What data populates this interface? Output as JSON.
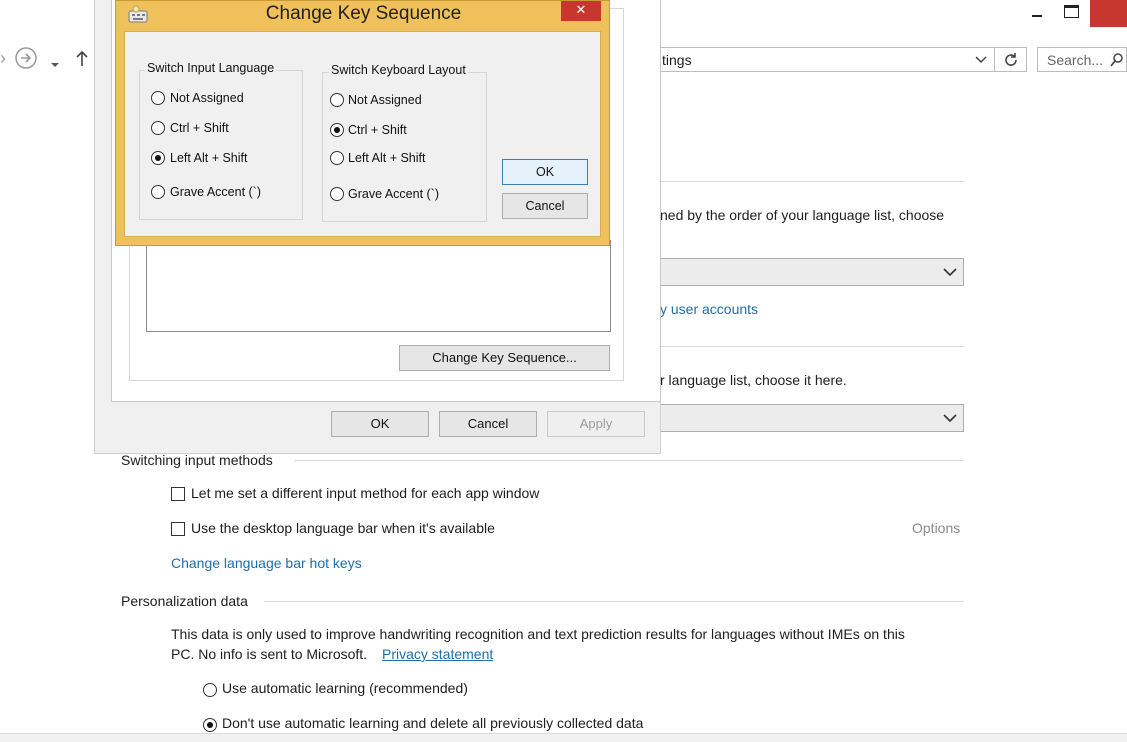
{
  "window": {
    "search_placeholder": "Search...",
    "address_text": "tings",
    "controls": {
      "minimize": "—",
      "maximize": "☐",
      "close": "✕"
    }
  },
  "main": {
    "text_order": "ned by the order of your language list, choose",
    "link_user_accounts": "y user accounts",
    "text_language_list": "r language list, choose it here.",
    "switching": {
      "header": "Switching input methods",
      "cb1_label": "Let me set a different input method for each app window",
      "cb2_label": "Use the desktop language bar when it's available",
      "options_label": "Options",
      "hotkeys_link": "Change language bar hot keys"
    },
    "personalization": {
      "header": "Personalization data",
      "desc_line1": "This data is only used to improve handwriting recognition and text prediction results for languages without IMEs on this",
      "desc_line2": "PC. No info is sent to Microsoft.",
      "privacy_link": "Privacy statement",
      "radio1_label": "Use automatic learning (recommended)",
      "radio2_label": "Don't use automatic learning and delete all previously collected data",
      "radio2_selected": true
    }
  },
  "bg_dialog": {
    "change_key_sequence_button": "Change Key Sequence...",
    "ok": "OK",
    "cancel": "Cancel",
    "apply": "Apply"
  },
  "key_dialog": {
    "title": "Change Key Sequence",
    "close": "✕",
    "group1": {
      "title": "Switch Input Language",
      "options": [
        "Not Assigned",
        "Ctrl + Shift",
        "Left Alt + Shift",
        "Grave Accent (`)"
      ],
      "selected": 2
    },
    "group2": {
      "title": "Switch Keyboard Layout",
      "options": [
        "Not Assigned",
        "Ctrl + Shift",
        "Left Alt + Shift",
        "Grave Accent (`)"
      ],
      "selected": 1
    },
    "ok": "OK",
    "cancel": "Cancel"
  },
  "colors": {
    "link": "#1e6fa8",
    "dialog_frame": "#f0c05a",
    "close_button": "#c7372f"
  },
  "icons": [
    "back-arrow-icon",
    "forward-arrow-icon",
    "up-arrow-icon",
    "refresh-icon",
    "search-icon",
    "keyboard-icon"
  ]
}
